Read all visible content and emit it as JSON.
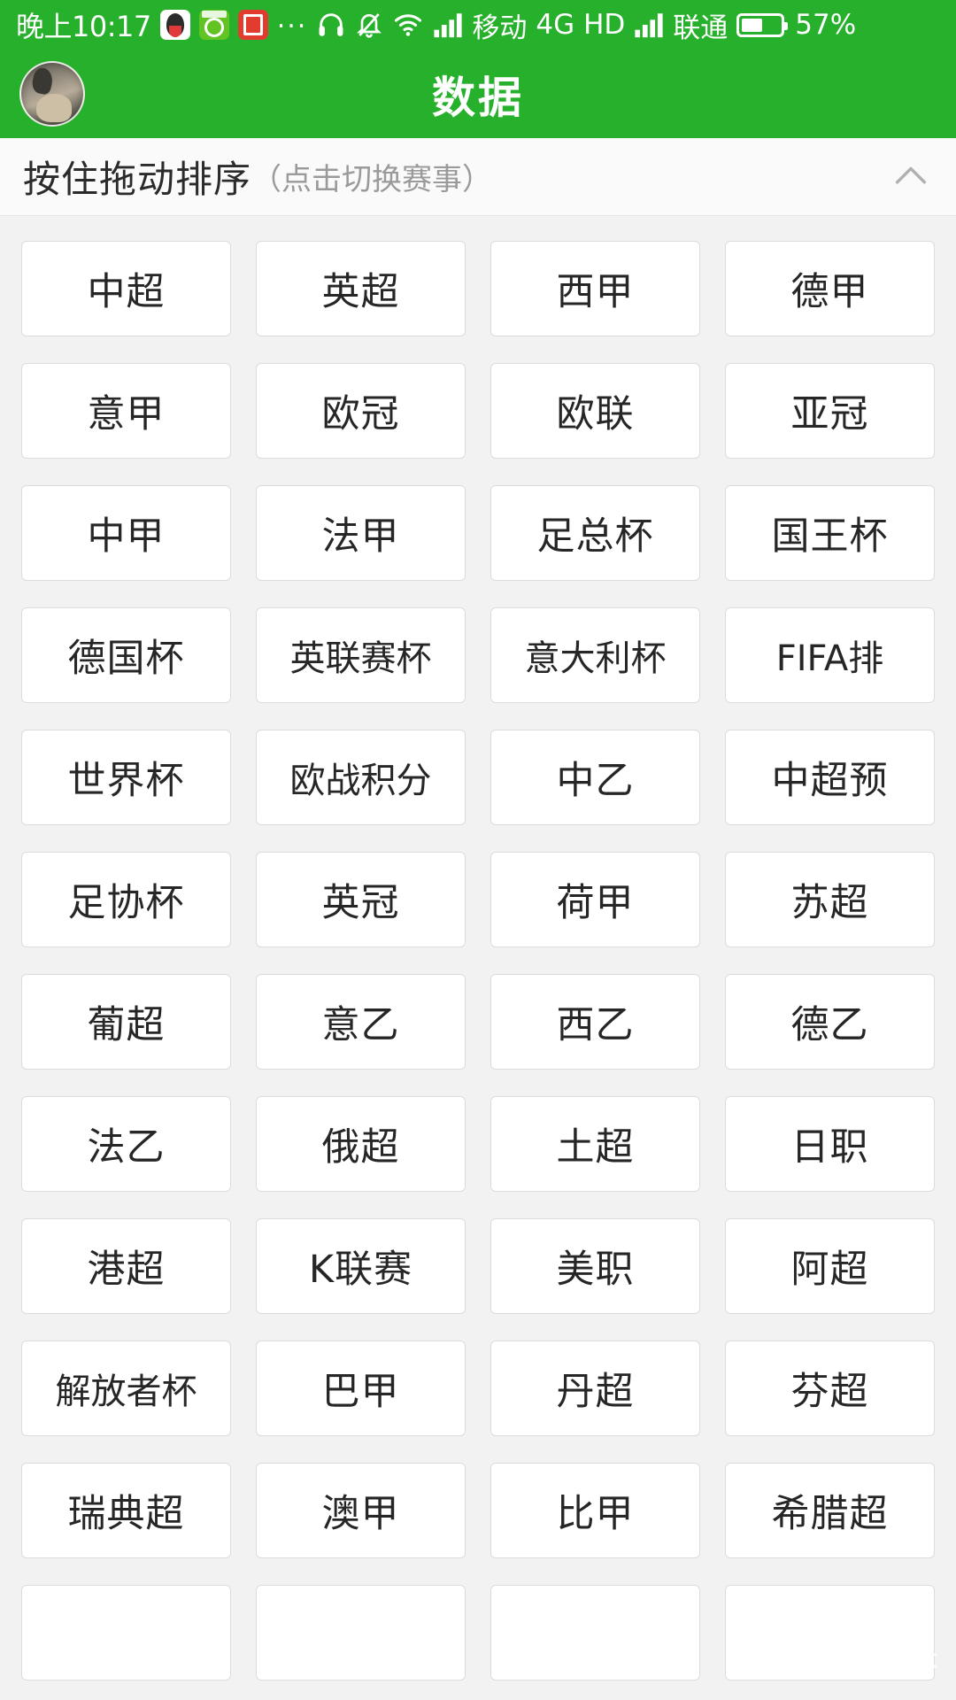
{
  "status_bar": {
    "time": "晚上10:17",
    "app_icons": [
      "qq-icon",
      "green-app-icon",
      "toutiao-icon"
    ],
    "overflow": "...",
    "icons": [
      "headset-icon",
      "bell-muted-icon",
      "wifi-icon",
      "signal-bars-icon"
    ],
    "carrier_primary": "移动",
    "network_type": "4G",
    "hd_label": "HD",
    "carrier_secondary": "联通",
    "battery_percent": "57%",
    "battery_level": 57,
    "background_color": "#27b02b"
  },
  "app_bar": {
    "title": "数据",
    "avatar": "user-avatar",
    "background_color": "#27b02b"
  },
  "section_header": {
    "title_main": "按住拖动排序",
    "title_sub": "（点击切换赛事）",
    "collapse_icon": "chevron-up-icon"
  },
  "leagues": [
    "中超",
    "英超",
    "西甲",
    "德甲",
    "意甲",
    "欧冠",
    "欧联",
    "亚冠",
    "中甲",
    "法甲",
    "足总杯",
    "国王杯",
    "德国杯",
    "英联赛杯",
    "意大利杯",
    "FIFA排",
    "世界杯",
    "欧战积分",
    "中乙",
    "中超预",
    "足协杯",
    "英冠",
    "荷甲",
    "苏超",
    "葡超",
    "意乙",
    "西乙",
    "德乙",
    "法乙",
    "俄超",
    "土超",
    "日职",
    "港超",
    "K联赛",
    "美职",
    "阿超",
    "解放者杯",
    "巴甲",
    "丹超",
    "芬超",
    "瑞典超",
    "澳甲",
    "比甲",
    "希腊超",
    "",
    "",
    "",
    ""
  ],
  "watermark": {
    "text": "悟空问答",
    "icon": "wukong-logo-icon"
  }
}
